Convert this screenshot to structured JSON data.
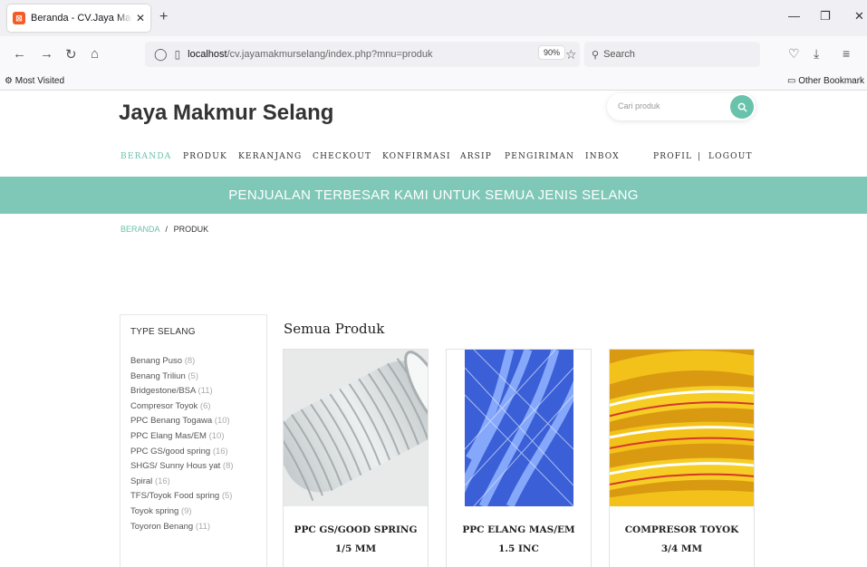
{
  "browser": {
    "tab_title": "Beranda - CV.Jaya Makmur Sela",
    "url_host": "localhost",
    "url_path": "/cv.jayamakmurselang/index.php?mnu=produk",
    "zoom": "90%",
    "search_placeholder": "Search",
    "bookmark_left": "Most Visited",
    "bookmark_right": "Other Bookmark"
  },
  "site": {
    "brand": "Jaya Makmur Selang",
    "search_placeholder": "Cari produk",
    "accent": "#69c2ab",
    "banner_color": "#7fc8b8"
  },
  "menu": {
    "beranda": "BERANDA",
    "produk": "PRODUK",
    "keranjang": "KERANJANG",
    "checkout": "CHECKOUT",
    "konfirmasi": "KONFIRMASI",
    "arsip": "ARSIP",
    "pengiriman": "PENGIRIMAN",
    "inbox": "INBOX",
    "profil": "PROFIL",
    "separator": "|",
    "logout": "LOGOUT"
  },
  "banner": "PENJUALAN TERBESAR KAMI UNTUK SEMUA JENIS SELANG",
  "breadcrumb": {
    "home": "BERANDA",
    "sep": "/",
    "current": "PRODUK"
  },
  "sidebar": {
    "heading": "TYPE SELANG",
    "items": [
      {
        "label": "Benang Puso",
        "count": "(8)"
      },
      {
        "label": "Benang Triliun",
        "count": "(5)"
      },
      {
        "label": "Bridgestone/BSA",
        "count": "(11)"
      },
      {
        "label": "Compresor Toyok",
        "count": "(6)"
      },
      {
        "label": "PPC Benang Togawa",
        "count": "(10)"
      },
      {
        "label": "PPC Elang Mas/EM",
        "count": "(10)"
      },
      {
        "label": "PPC GS/good spring",
        "count": "(16)"
      },
      {
        "label": "SHGS/ Sunny Hous yat",
        "count": "(8)"
      },
      {
        "label": "Spiral",
        "count": "(16)"
      },
      {
        "label": "TFS/Toyok Food spring",
        "count": "(5)"
      },
      {
        "label": "Toyok spring",
        "count": "(9)"
      },
      {
        "label": "Toyoron Benang",
        "count": "(11)"
      }
    ]
  },
  "products": {
    "title": "Semua Produk",
    "items": [
      {
        "name": "PPC GS/GOOD SPRING",
        "size": "1/5 MM"
      },
      {
        "name": "PPC ELANG MAS/EM",
        "size": "1.5 INC"
      },
      {
        "name": "COMPRESOR TOYOK",
        "size": "3/4 MM"
      }
    ]
  }
}
